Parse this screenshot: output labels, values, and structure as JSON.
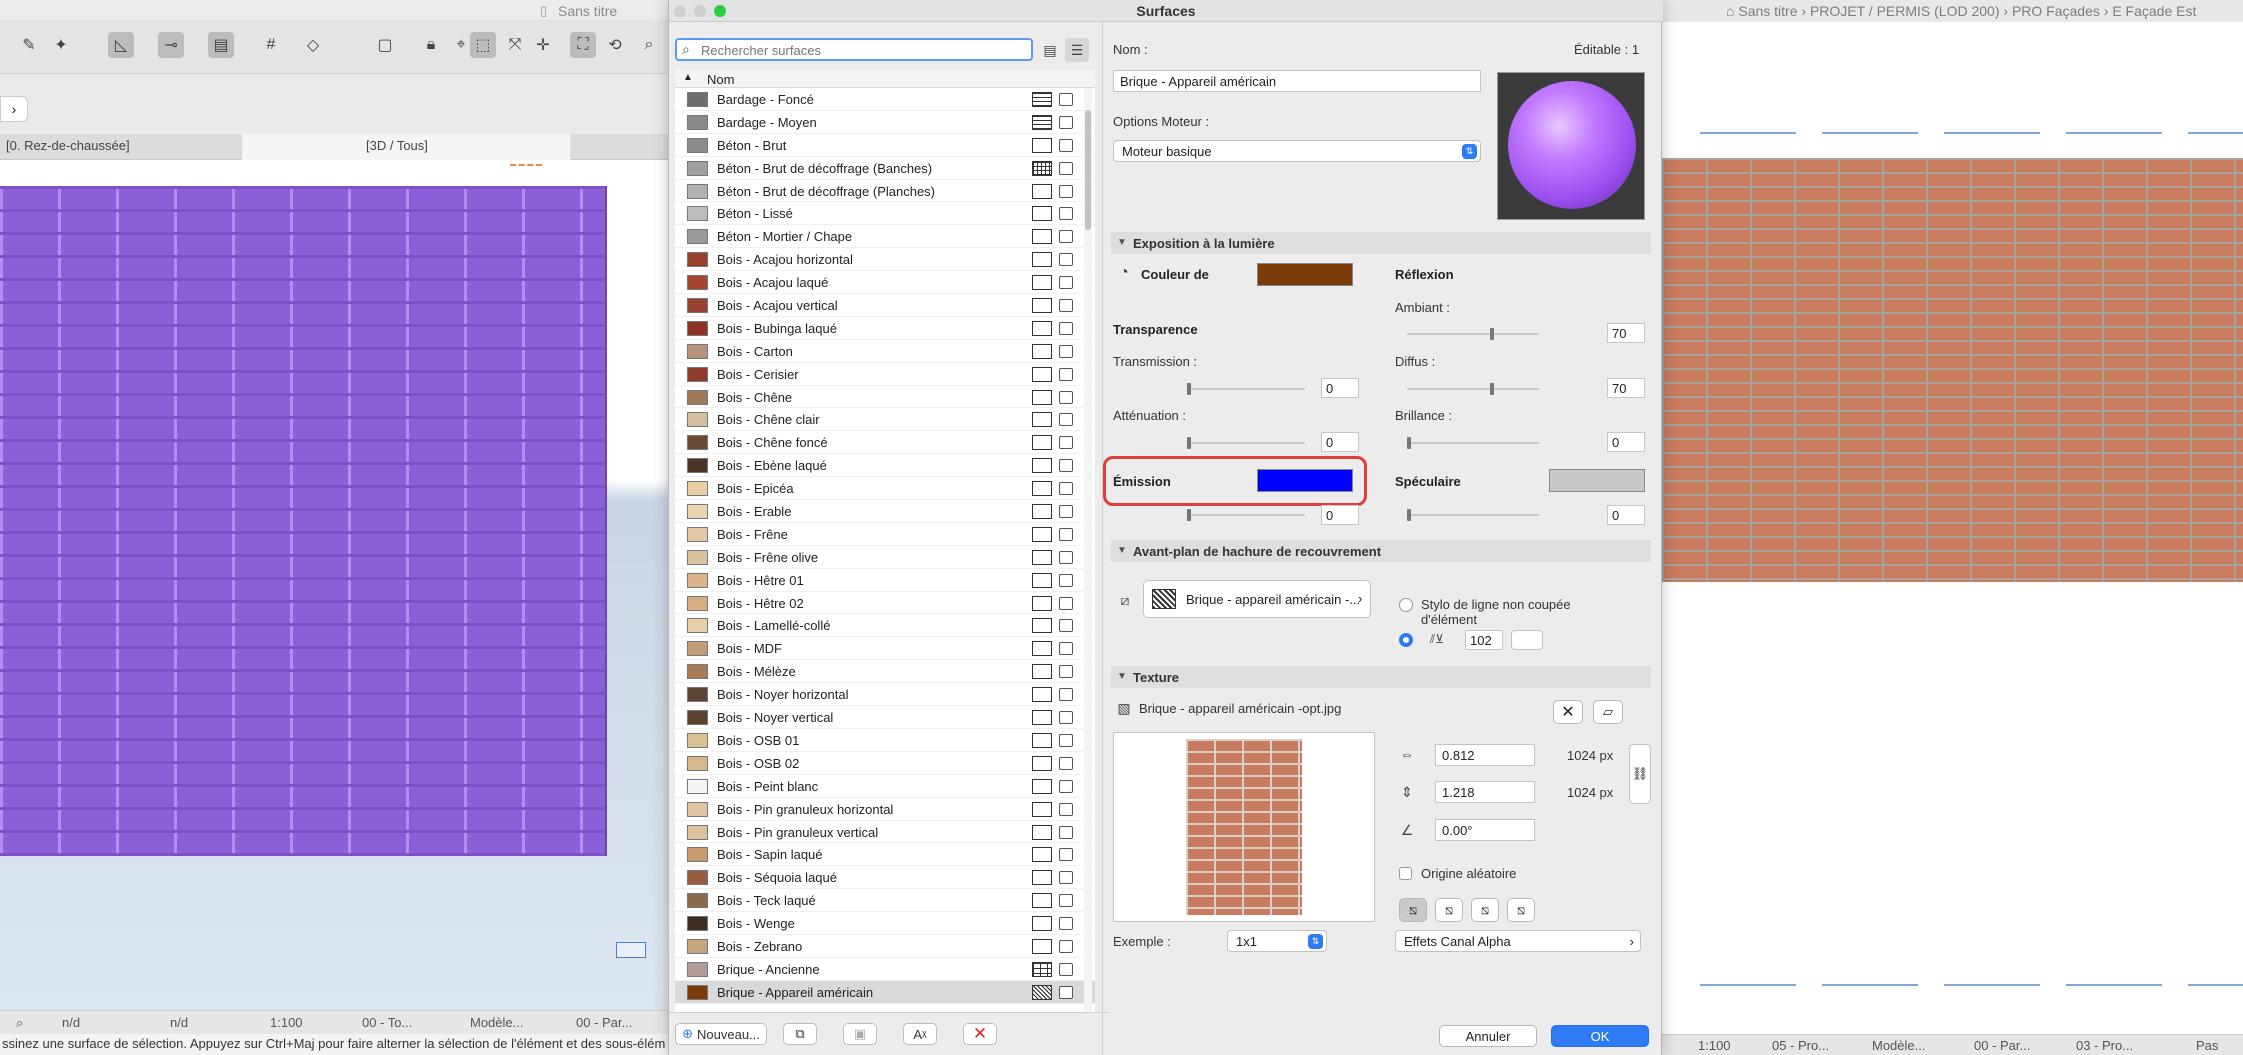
{
  "left_window": {
    "title": "Sans titre",
    "tabs": [
      "[0. Rez-de-chaussée]",
      "[3D / Tous]"
    ],
    "status": {
      "nd1": "n/d",
      "nd2": "n/d",
      "scale": "1:100",
      "layer": "00 - To...",
      "model": "Modèle...",
      "partial": "00 - Par..."
    },
    "message": "ssinez une surface de sélection. Appuyez sur Ctrl+Maj pour faire alterner la sélection de l'élément et des sous-élém"
  },
  "right_window": {
    "breadcrumb": "Sans titre › PROJET / PERMIS (LOD 200) › PRO Façades › E Façade Est",
    "status": {
      "scale": "1:100",
      "layer": "05 - Pro...",
      "model": "Modèle...",
      "partial": "00 - Par...",
      "view": "03 - Pro...",
      "pas": "Pas"
    }
  },
  "dialog": {
    "title": "Surfaces",
    "search_placeholder": "Rechercher surfaces",
    "column_name": "Nom",
    "surfaces": [
      {
        "name": "Bardage - Foncé",
        "color": "#6f6f6f",
        "hatch": "lines"
      },
      {
        "name": "Bardage - Moyen",
        "color": "#8a8a8a",
        "hatch": "lines"
      },
      {
        "name": "Béton - Brut",
        "color": "#8c8c8c",
        "hatch": "none"
      },
      {
        "name": "Béton - Brut de décoffrage (Banches)",
        "color": "#a0a0a0",
        "hatch": "grid"
      },
      {
        "name": "Béton - Brut de décoffrage (Planches)",
        "color": "#b0b0b0",
        "hatch": "none"
      },
      {
        "name": "Béton - Lissé",
        "color": "#bcbcbc",
        "hatch": "none"
      },
      {
        "name": "Béton - Mortier / Chape",
        "color": "#9a9a9a",
        "hatch": "none"
      },
      {
        "name": "Bois - Acajou horizontal",
        "color": "#9a3f2b",
        "hatch": "none"
      },
      {
        "name": "Bois - Acajou laqué",
        "color": "#a4452f",
        "hatch": "none"
      },
      {
        "name": "Bois - Acajou vertical",
        "color": "#97402c",
        "hatch": "none"
      },
      {
        "name": "Bois - Bubinga laqué",
        "color": "#8f3424",
        "hatch": "none"
      },
      {
        "name": "Bois - Carton",
        "color": "#b8927a",
        "hatch": "none"
      },
      {
        "name": "Bois - Cerisier",
        "color": "#8e3b29",
        "hatch": "none"
      },
      {
        "name": "Bois - Chêne",
        "color": "#a07a58",
        "hatch": "none"
      },
      {
        "name": "Bois - Chêne clair",
        "color": "#d6bfa1",
        "hatch": "none"
      },
      {
        "name": "Bois - Chêne foncé",
        "color": "#6b4a33",
        "hatch": "none"
      },
      {
        "name": "Bois - Ebène laqué",
        "color": "#4a3426",
        "hatch": "none"
      },
      {
        "name": "Bois - Epicéa",
        "color": "#e8cfa2",
        "hatch": "none"
      },
      {
        "name": "Bois - Erable",
        "color": "#ead4b0",
        "hatch": "none"
      },
      {
        "name": "Bois - Frêne",
        "color": "#e3c9a3",
        "hatch": "none"
      },
      {
        "name": "Bois - Frêne olive",
        "color": "#d9c19e",
        "hatch": "none"
      },
      {
        "name": "Bois - Hêtre 01",
        "color": "#dbb489",
        "hatch": "none"
      },
      {
        "name": "Bois - Hêtre 02",
        "color": "#d8ad80",
        "hatch": "none"
      },
      {
        "name": "Bois - Lamellé-collé",
        "color": "#e7d0a6",
        "hatch": "none"
      },
      {
        "name": "Bois - MDF",
        "color": "#c49a76",
        "hatch": "none"
      },
      {
        "name": "Bois - Mélèze",
        "color": "#a87a55",
        "hatch": "none"
      },
      {
        "name": "Bois - Noyer horizontal",
        "color": "#5c4332",
        "hatch": "none"
      },
      {
        "name": "Bois - Noyer vertical",
        "color": "#5a4130",
        "hatch": "none"
      },
      {
        "name": "Bois - OSB 01",
        "color": "#dcbf92",
        "hatch": "none"
      },
      {
        "name": "Bois - OSB 02",
        "color": "#d6b88a",
        "hatch": "none"
      },
      {
        "name": "Bois - Peint blanc",
        "color": "#f4f4f4",
        "hatch": "none"
      },
      {
        "name": "Bois - Pin granuleux horizontal",
        "color": "#dfc6a0",
        "hatch": "none"
      },
      {
        "name": "Bois - Pin granuleux vertical",
        "color": "#dcc39c",
        "hatch": "none"
      },
      {
        "name": "Bois - Sapin laqué",
        "color": "#c89b6e",
        "hatch": "none"
      },
      {
        "name": "Bois - Séquoia laqué",
        "color": "#9a5a3c",
        "hatch": "none"
      },
      {
        "name": "Bois - Teck laqué",
        "color": "#8d6a4b",
        "hatch": "none"
      },
      {
        "name": "Bois - Wenge",
        "color": "#3e2d21",
        "hatch": "none"
      },
      {
        "name": "Bois - Zebrano",
        "color": "#c6a57e",
        "hatch": "none"
      },
      {
        "name": "Brique - Ancienne",
        "color": "#b39a95",
        "hatch": "brick"
      },
      {
        "name": "Brique - Appareil américain",
        "color": "#7a3b0b",
        "hatch": "dense",
        "selected": true
      }
    ],
    "buttons": {
      "new": "Nouveau...",
      "cancel": "Annuler",
      "ok": "OK"
    },
    "props": {
      "name_label": "Nom :",
      "editable": "Éditable : 1",
      "name_value": "Brique - Appareil américain",
      "engine_label": "Options Moteur :",
      "engine_value": "Moteur basique",
      "exposure_title": "Exposition à la lumière",
      "color_label": "Couleur de",
      "color": "#7a3b0b",
      "reflection_title": "Réflexion",
      "ambient_label": "Ambiant :",
      "ambient_value": "70",
      "transparency_title": "Transparence",
      "transmission_label": "Transmission :",
      "transmission_value": "0",
      "diffuse_label": "Diffus :",
      "diffuse_value": "70",
      "attenuation_label": "Atténuation :",
      "attenuation_value": "0",
      "brilliance_label": "Brillance :",
      "brilliance_value": "0",
      "emission_label": "Émission",
      "emission_color": "#0000ff",
      "emission_value": "0",
      "specular_label": "Spéculaire",
      "specular_color": "#c8c8c8",
      "specular_value": "0",
      "hatch_title": "Avant-plan de hachure de recouvrement",
      "hatch_value": "Brique - appareil américain -...",
      "uncut_line_label": "Stylo de ligne non coupée d'élément",
      "pen_number": "102",
      "texture_title": "Texture",
      "texture_file": "Brique - appareil américain -opt.jpg",
      "width_value": "0.812",
      "width_px": "1024 px",
      "height_value": "1.218",
      "height_px": "1024 px",
      "angle_value": "0.00°",
      "random_origin_label": "Origine aléatoire",
      "example_label": "Exemple :",
      "example_value": "1x1",
      "alpha_effects": "Effets Canal Alpha"
    }
  }
}
